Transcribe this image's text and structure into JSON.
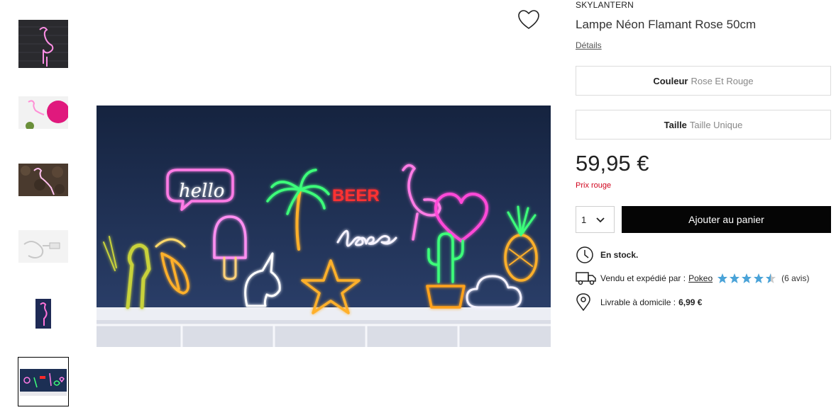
{
  "thumbnails": [
    {
      "name": "flamingo neon on brick wall",
      "selected": false
    },
    {
      "name": "flamingo neon with pink lanterns",
      "selected": false
    },
    {
      "name": "flamingo neon on stone wall",
      "selected": false
    },
    {
      "name": "neon light cable",
      "selected": false
    },
    {
      "name": "flamingo neon packaging",
      "selected": false
    },
    {
      "name": "neon collection shelf",
      "selected": true
    }
  ],
  "main_image": {
    "neon_texts": {
      "hello": "hello",
      "beer": "BEER",
      "love": "love"
    }
  },
  "product": {
    "brand": "SKYLANTERN",
    "title": "Lampe Néon Flamant Rose 50cm",
    "details_link": "Détails",
    "color": {
      "label": "Couleur",
      "value": "Rose Et Rouge"
    },
    "size": {
      "label": "Taille",
      "value": "Taille Unique"
    },
    "price": "59,95 €",
    "price_note": "Prix rouge",
    "quantity": "1",
    "add_to_cart": "Ajouter au panier",
    "stock": "En stock.",
    "seller_prefix": "Vendu et expédié par :",
    "seller": "Pokeo",
    "rating": 4.5,
    "reviews": "(6 avis)",
    "delivery_prefix": "Livrable à domicile :",
    "delivery_price": "6,99 €"
  },
  "colors": {
    "price_note": "#d0021b",
    "button_bg": "#050505",
    "star": "#4aa3d8",
    "neon_pink": "#ff7be6",
    "neon_green": "#3dff7a",
    "neon_red": "#ff2a2a",
    "neon_yellow": "#ffcf4a",
    "wall": "#1c2f54"
  },
  "icons": [
    "heart-icon",
    "chevron-down-icon",
    "clock-icon",
    "truck-icon",
    "location-pin-icon",
    "star-icon"
  ]
}
